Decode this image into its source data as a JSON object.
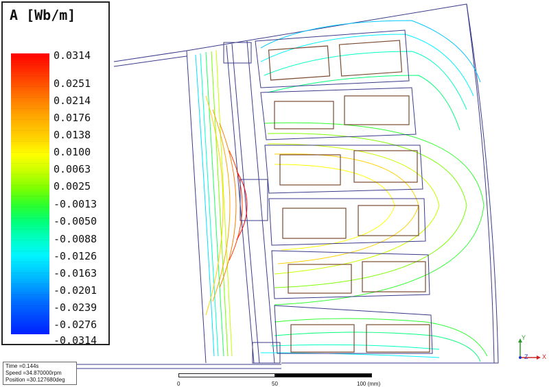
{
  "legend": {
    "title": "A [Wb/m]",
    "ticks": [
      "0.0314",
      "0.0251",
      "0.0214",
      "0.0176",
      "0.0138",
      "0.0100",
      "0.0063",
      "0.0025",
      "-0.0013",
      "-0.0050",
      "-0.0088",
      "-0.0126",
      "-0.0163",
      "-0.0201",
      "-0.0239",
      "-0.0276",
      "-0.0314"
    ],
    "colormap": [
      "#ff0000",
      "#ffa500",
      "#ffff00",
      "#7dff00",
      "#00ff7a",
      "#00f5ff",
      "#0070ff",
      "#0020ff"
    ]
  },
  "info": {
    "time": "Time    =0.144s",
    "speed": "Speed    =34.870000rpm",
    "position": "Position =30.127680deg"
  },
  "scale": {
    "labels": [
      "0",
      "50",
      "100 (mm)"
    ]
  },
  "triad": {
    "y_label": "Y",
    "x_label": "X",
    "z_label": "Z"
  },
  "colors": {
    "outline": "#3a3a8a",
    "slot": "#7a4a30"
  }
}
